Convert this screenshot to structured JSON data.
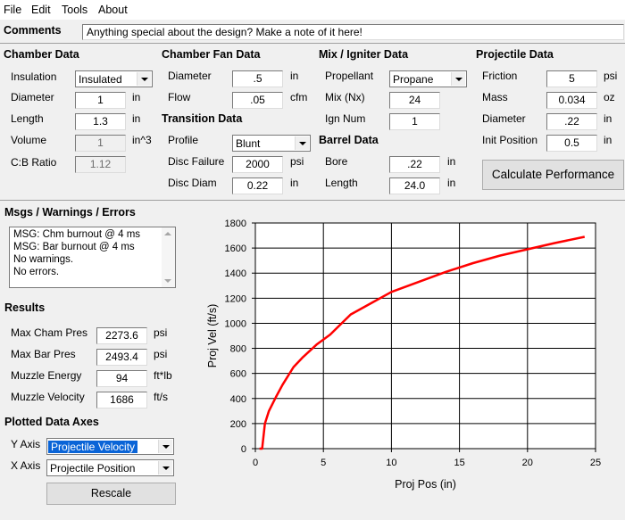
{
  "menu": {
    "file": "File",
    "edit": "Edit",
    "tools": "Tools",
    "about": "About"
  },
  "comments": {
    "label": "Comments",
    "value": "Anything special about the design?  Make a note of it here!"
  },
  "chamber": {
    "title": "Chamber Data",
    "insulation_label": "Insulation",
    "insulation_value": "Insulated",
    "diameter_label": "Diameter",
    "diameter_value": "1",
    "diameter_unit": "in",
    "length_label": "Length",
    "length_value": "1.3",
    "length_unit": "in",
    "volume_label": "Volume",
    "volume_value": "1",
    "volume_unit": "in^3",
    "cb_label": "C:B Ratio",
    "cb_value": "1.12"
  },
  "fan": {
    "title": "Chamber Fan Data",
    "diameter_label": "Diameter",
    "diameter_value": ".5",
    "diameter_unit": "in",
    "flow_label": "Flow",
    "flow_value": ".05",
    "flow_unit": "cfm"
  },
  "transition": {
    "title": "Transition Data",
    "profile_label": "Profile",
    "profile_value": "Blunt",
    "disc_failure_label": "Disc Failure",
    "disc_failure_value": "2000",
    "disc_failure_unit": "psi",
    "disc_diam_label": "Disc Diam",
    "disc_diam_value": "0.22",
    "disc_diam_unit": "in"
  },
  "igniter": {
    "title": "Mix / Igniter Data",
    "propellant_label": "Propellant",
    "propellant_value": "Propane",
    "mix_label": "Mix (Nx)",
    "mix_value": "24",
    "ign_label": "Ign Num",
    "ign_value": "1"
  },
  "barrel": {
    "title": "Barrel Data",
    "bore_label": "Bore",
    "bore_value": ".22",
    "bore_unit": "in",
    "length_label": "Length",
    "length_value": "24.0",
    "length_unit": "in"
  },
  "projectile": {
    "title": "Projectile Data",
    "friction_label": "Friction",
    "friction_value": "5",
    "friction_unit": "psi",
    "mass_label": "Mass",
    "mass_value": "0.034",
    "mass_unit": "oz",
    "diameter_label": "Diameter",
    "diameter_value": ".22",
    "diameter_unit": "in",
    "init_label": "Init Position",
    "init_value": "0.5",
    "init_unit": "in"
  },
  "calculate_label": "Calculate Performance",
  "messages": {
    "title": "Msgs / Warnings / Errors",
    "lines": [
      "MSG: Chm burnout @ 4 ms",
      "MSG: Bar burnout @ 4 ms",
      "No warnings.",
      "No errors."
    ]
  },
  "results": {
    "title": "Results",
    "max_cham_label": "Max Cham Pres",
    "max_cham_value": "2273.6",
    "max_cham_unit": "psi",
    "max_bar_label": "Max Bar Pres",
    "max_bar_value": "2493.4",
    "max_bar_unit": "psi",
    "energy_label": "Muzzle Energy",
    "energy_value": "94",
    "energy_unit": "ft*lb",
    "velocity_label": "Muzzle Velocity",
    "velocity_value": "1686",
    "velocity_unit": "ft/s"
  },
  "axes": {
    "title": "Plotted Data Axes",
    "y_label": "Y Axis",
    "y_value": "Projectile Velocity",
    "x_label": "X Axis",
    "x_value": "Projectile Position"
  },
  "rescale_label": "Rescale",
  "colors": {
    "series": "#ff0000",
    "selection": "#0a64d7"
  },
  "chart_data": {
    "type": "line",
    "xlabel": "Proj Pos (in)",
    "ylabel": "Proj Vel (ft/s)",
    "xlim": [
      0,
      25
    ],
    "ylim": [
      0,
      1800
    ],
    "xticks": [
      0,
      5,
      10,
      15,
      20,
      25
    ],
    "yticks": [
      0,
      200,
      400,
      600,
      800,
      1000,
      1200,
      1400,
      1600,
      1800
    ],
    "grid": true,
    "series": [
      {
        "color": "#ff0000",
        "x": [
          0.3,
          0.5,
          0.7,
          1.0,
          1.5,
          2.0,
          2.8,
          3.5,
          4.5,
          5.5,
          7.0,
          8.5,
          10.0,
          12.0,
          14.0,
          16.0,
          18.0,
          20.0,
          22.0,
          24.2
        ],
        "y": [
          0,
          0,
          200,
          300,
          410,
          510,
          650,
          730,
          830,
          910,
          1070,
          1160,
          1250,
          1330,
          1410,
          1480,
          1540,
          1590,
          1640,
          1690
        ]
      }
    ]
  }
}
